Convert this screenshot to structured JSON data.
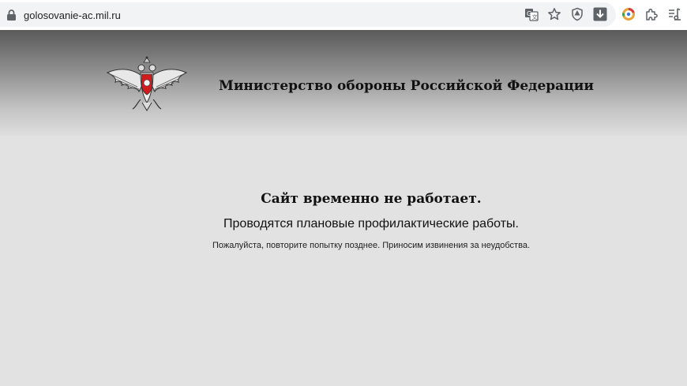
{
  "browser": {
    "url": "golosovanie-ac.mil.ru",
    "icons": [
      "lock-icon",
      "translate-icon",
      "star-icon",
      "shield-icon",
      "download-icon",
      "extension-color-icon",
      "puzzle-icon",
      "reading-list-icon"
    ]
  },
  "header": {
    "ministry_title": "Министерство обороны Российской Федерации",
    "emblem": "double-headed-eagle-emblem"
  },
  "message": {
    "title": "Сайт временно не работает.",
    "subtitle": "Проводятся плановые профилактические работы.",
    "note": "Пожалуйста, повторите попытку позднее. Приносим извинения за неудобства."
  },
  "colors": {
    "page_background": "#e2e2e2",
    "header_top": "#5a5a5a",
    "emblem_red": "#d01c1c"
  }
}
